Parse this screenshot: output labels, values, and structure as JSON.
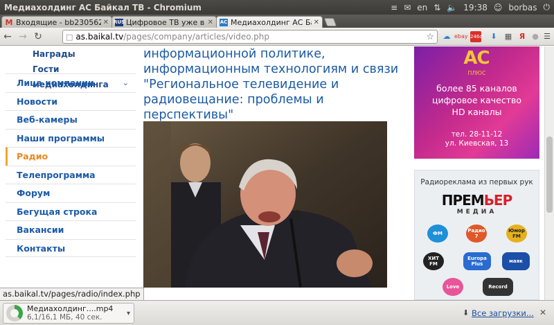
{
  "window": {
    "title": "Медиахолдинг АС Байкал ТВ - Chromium"
  },
  "tray": {
    "lang": "en",
    "time": "19:38",
    "user": "borbas"
  },
  "tabs": [
    {
      "label": "Входящие - bb230562@g",
      "favicon": "M",
      "fav_color": "#d93025"
    },
    {
      "label": "Цифровое ТВ уже в Ирк",
      "favicon": "RUS",
      "fav_color": "#1f3b7a"
    },
    {
      "label": "Медиахолдинг АС Байкал",
      "favicon": "AC",
      "fav_color": "#2a7cc7"
    }
  ],
  "toolbar": {
    "url_host": "as.baikal.tv",
    "url_path": "/pages/company/articles/video.php",
    "ext_badge": "246d"
  },
  "subnav": [
    "Награды",
    "Гости медиахолдинга"
  ],
  "nav": [
    {
      "label": "Лица компании",
      "active": false,
      "expand": true
    },
    {
      "label": "Новости",
      "active": false
    },
    {
      "label": "Веб-камеры",
      "active": false
    },
    {
      "label": "Наши программы",
      "active": false
    },
    {
      "label": "Радио",
      "active": true
    },
    {
      "label": "Телепрограмма",
      "active": false
    },
    {
      "label": "Форум",
      "active": false
    },
    {
      "label": "Бегущая строка",
      "active": false
    },
    {
      "label": "Вакансии",
      "active": false
    },
    {
      "label": "Контакты",
      "active": false
    }
  ],
  "article": {
    "title_lines": [
      "информационной политике,",
      "информационным технологиям и связи",
      "\"Региональное телевидение и",
      "радиовещание: проблемы и перспективы\""
    ]
  },
  "banner1": {
    "logo": "АС",
    "logo_sub": "ПЛЮС",
    "lines": [
      "более 85 каналов",
      "цифровое качество",
      "HD каналы"
    ],
    "tel": "тел. 28-11-12",
    "addr": "ул. Киевская, 13"
  },
  "banner2": {
    "caption": "Радиореклама из первых рук",
    "brand_a": "ПРЕМ",
    "brand_b": "ЬЕР",
    "brand_sub": "МЕДИА",
    "logos": [
      {
        "label": "ФМ",
        "color": "#1f8fd8"
      },
      {
        "label": "Радио 7",
        "color": "#e0582a"
      },
      {
        "label": "Юмор FM",
        "color": "#e6b01e"
      },
      {
        "label": "ХИТ FM",
        "color": "#222222"
      },
      {
        "label": "Europa Plus",
        "color": "#2a6bd1"
      },
      {
        "label": "маяк",
        "color": "#1b4fa8"
      },
      {
        "label": "Love",
        "color": "#e8559a"
      },
      {
        "label": "Record",
        "color": "#333333"
      }
    ]
  },
  "status_url": "as.baikal.tv/pages/radio/index.php",
  "download": {
    "name": "Медиахолдинг....mp4",
    "meta": "6,1/16,1 МБ, 40 сек.",
    "progress": 0.38,
    "all_label": "Все загрузки..."
  }
}
